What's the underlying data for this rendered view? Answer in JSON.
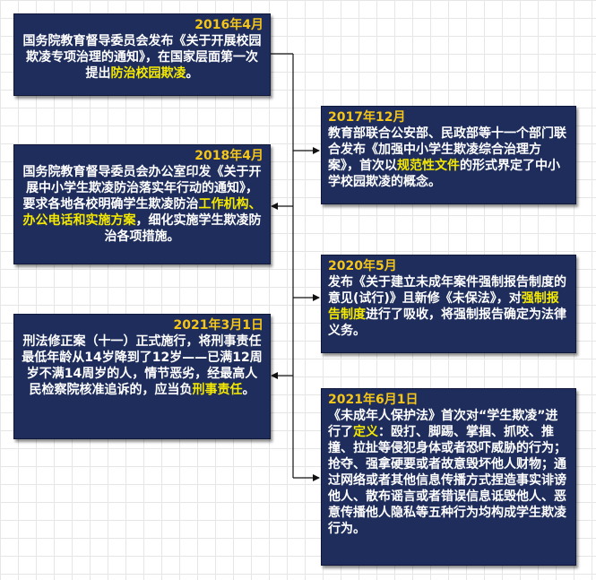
{
  "events": [
    {
      "date": "2016年4月",
      "segments": [
        {
          "text": "国务院教育督导委员会发布《关于开展校园欺凌专项治理的通知》，在国家层面第一次提出",
          "hl": false
        },
        {
          "text": "防治校园欺凌",
          "hl": true
        },
        {
          "text": "。",
          "hl": false
        }
      ]
    },
    {
      "date": "2017年12月",
      "segments": [
        {
          "text": "教育部联合公安部、民政部等十一个部门联合发布《加强中小学生欺凌综合治理方案》，首次以",
          "hl": false
        },
        {
          "text": "规范性文件",
          "hl": true
        },
        {
          "text": "的形式界定了中小学校园欺凌的概念。",
          "hl": false
        }
      ]
    },
    {
      "date": "2018年4月",
      "segments": [
        {
          "text": "国务院教育督导委员会办公室印发《关于开展中小学生欺凌防治落实年行动的通知》，要求各地各校明确学生欺凌防治",
          "hl": false
        },
        {
          "text": "工作机构、办公电话和实施方案",
          "hl": true
        },
        {
          "text": "，细化实施学生欺凌防治各项措施。",
          "hl": false
        }
      ]
    },
    {
      "date": "2020年5月",
      "segments": [
        {
          "text": "发布《关于建立未成年案件强制报告制度的意见(试行)》且新修《未保法》，对",
          "hl": false
        },
        {
          "text": "强制报告制度",
          "hl": true
        },
        {
          "text": "进行了吸收，将强制报告确定为法律义务。",
          "hl": false
        }
      ]
    },
    {
      "date": "2021年3月1日",
      "segments": [
        {
          "text": "刑法修正案（十一）正式施行，将刑事责任最低年龄从14岁降到了12岁——已满12周岁不满14周岁的人，情节恶劣，经最高人民检察院核准追诉的，应当负",
          "hl": false
        },
        {
          "text": "刑事责任",
          "hl": true
        },
        {
          "text": "。",
          "hl": false
        }
      ]
    },
    {
      "date": "2021年6月1日",
      "segments": [
        {
          "text": "《未成年人保护法》首次对“学生欺凌”进行了",
          "hl": false
        },
        {
          "text": "定义",
          "hl": true
        },
        {
          "text": "：殴打、脚踢、掌掴、抓咬、推撞、拉扯等侵犯身体或者恐吓威胁的行为；抢夺、强拿硬要或者故意毁坏他人财物；通过网络或者其他信息传播方式捏造事实诽谤他人、散布谣言或者错误信息诋毁他人、恶意传播他人隐私等五种行为均构成学生欺凌行为。",
          "hl": false
        }
      ]
    }
  ]
}
